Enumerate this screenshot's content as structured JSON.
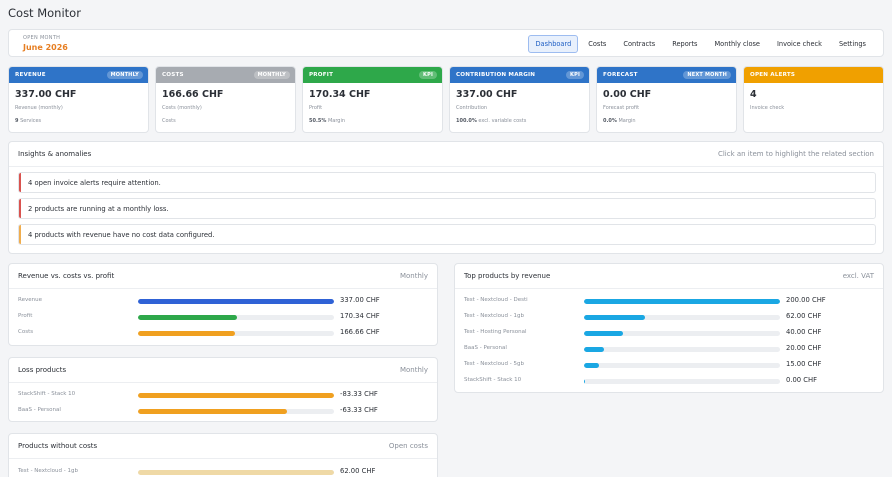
{
  "app": {
    "title": "Cost Monitor"
  },
  "topbar": {
    "open_month_label": "OPEN MONTH",
    "open_month_value": "June 2026",
    "nav": [
      "Dashboard",
      "Costs",
      "Contracts",
      "Reports",
      "Monthly close",
      "Invoice check",
      "Settings"
    ],
    "active": "Dashboard"
  },
  "kpis": [
    {
      "title": "REVENUE",
      "badge": "MONTHLY",
      "color": "#2f74c8",
      "value": "337.00 CHF",
      "sub": "Revenue (monthly)",
      "note_strong": "9",
      "note": "Services"
    },
    {
      "title": "COSTS",
      "badge": "MONTHLY",
      "color": "#a7abb1",
      "value": "166.66 CHF",
      "sub": "Costs (monthly)",
      "note_strong": "",
      "note": "Costs"
    },
    {
      "title": "PROFIT",
      "badge": "KPI",
      "color": "#2ea84a",
      "value": "170.34 CHF",
      "sub": "Profit",
      "note_strong": "50.5%",
      "note": "Margin"
    },
    {
      "title": "CONTRIBUTION MARGIN",
      "badge": "KPI",
      "color": "#2f74c8",
      "value": "337.00 CHF",
      "sub": "Contribution",
      "note_strong": "100.0%",
      "note": "excl. variable costs"
    },
    {
      "title": "FORECAST",
      "badge": "NEXT MONTH",
      "color": "#2f74c8",
      "value": "0.00 CHF",
      "sub": "Forecast profit",
      "note_strong": "0.0%",
      "note": "Margin"
    },
    {
      "title": "OPEN ALERTS",
      "badge": "",
      "color": "#f0a000",
      "value": "4",
      "sub": "Invoice check",
      "note_strong": "",
      "note": ""
    }
  ],
  "insights": {
    "title": "Insights & anomalies",
    "hint": "Click an item to highlight the related section",
    "items": [
      {
        "text": "4 open invoice alerts require attention.",
        "color": "#d9534f"
      },
      {
        "text": "2 products are running at a monthly loss.",
        "color": "#d9534f"
      },
      {
        "text": "4 products with revenue have no cost data configured.",
        "color": "#f0ad4e"
      }
    ]
  },
  "rev_costs": {
    "title": "Revenue vs. costs vs. profit",
    "hint": "Monthly",
    "rows": [
      {
        "label": "Revenue",
        "value": "337.00 CHF",
        "fill": 1.0,
        "color": "#2f62d6"
      },
      {
        "label": "Profit",
        "value": "170.34 CHF",
        "fill": 0.505,
        "color": "#2ea84a"
      },
      {
        "label": "Costs",
        "value": "166.66 CHF",
        "fill": 0.495,
        "color": "#f0a020"
      }
    ]
  },
  "loss": {
    "title": "Loss products",
    "hint": "Monthly",
    "rows": [
      {
        "label": "StackShift - Stack 10",
        "value": "-83.33 CHF",
        "fill": 1.0,
        "color": "#f0a020"
      },
      {
        "label": "BaaS - Personal",
        "value": "-63.33 CHF",
        "fill": 0.76,
        "color": "#f0a020"
      }
    ]
  },
  "no_costs": {
    "title": "Products without costs",
    "hint": "Open costs",
    "rows": [
      {
        "label": "Test - Nextcloud - 1gb",
        "value": "62.00 CHF",
        "fill": 1.0,
        "color": "#efd9a6"
      }
    ]
  },
  "top_products": {
    "title": "Top products by revenue",
    "hint": "excl. VAT",
    "rows": [
      {
        "label": "Test - Nextcloud - Desti",
        "value": "200.00 CHF",
        "fill": 1.0,
        "color": "#1aa7e3"
      },
      {
        "label": "Test - Nextcloud - 1gb",
        "value": "62.00 CHF",
        "fill": 0.31,
        "color": "#1aa7e3"
      },
      {
        "label": "Test - Hosting Personal",
        "value": "40.00 CHF",
        "fill": 0.2,
        "color": "#1aa7e3"
      },
      {
        "label": "BaaS - Personal",
        "value": "20.00 CHF",
        "fill": 0.1,
        "color": "#1aa7e3"
      },
      {
        "label": "Test - Nextcloud - 5gb",
        "value": "15.00 CHF",
        "fill": 0.075,
        "color": "#1aa7e3"
      },
      {
        "label": "StackShift - Stack 10",
        "value": "0.00 CHF",
        "fill": 0.006,
        "color": "#1aa7e3"
      }
    ]
  }
}
